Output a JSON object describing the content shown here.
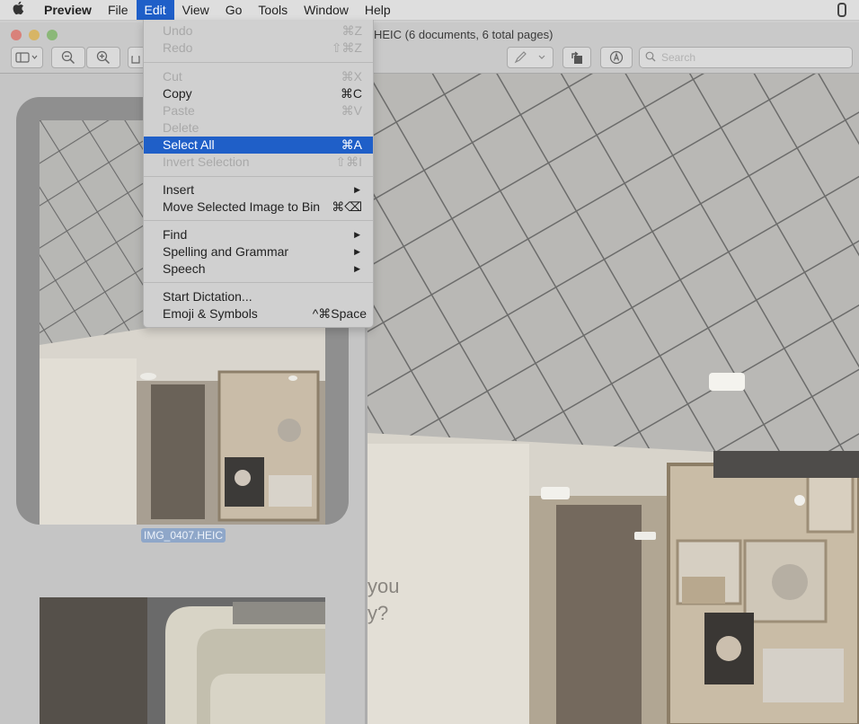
{
  "menubar": {
    "items": [
      "Preview",
      "File",
      "Edit",
      "View",
      "Go",
      "Tools",
      "Window",
      "Help"
    ]
  },
  "window": {
    "title": "HEIC (6 documents, 6 total pages)"
  },
  "search": {
    "placeholder": "Search"
  },
  "sidebar": {
    "thumbnail_label": "IMG_0407.HEIC"
  },
  "edit_menu": {
    "undo": {
      "label": "Undo",
      "shortcut": "⌘Z"
    },
    "redo": {
      "label": "Redo",
      "shortcut": "⇧⌘Z"
    },
    "cut": {
      "label": "Cut",
      "shortcut": "⌘X"
    },
    "copy": {
      "label": "Copy",
      "shortcut": "⌘C"
    },
    "paste": {
      "label": "Paste",
      "shortcut": "⌘V"
    },
    "delete": {
      "label": "Delete"
    },
    "select_all": {
      "label": "Select All",
      "shortcut": "⌘A"
    },
    "invert_selection": {
      "label": "Invert Selection",
      "shortcut": "⇧⌘I"
    },
    "insert": {
      "label": "Insert"
    },
    "move_to_bin": {
      "label": "Move Selected Image to Bin",
      "shortcut": "⌘⌫"
    },
    "find": {
      "label": "Find"
    },
    "spelling": {
      "label": "Spelling and Grammar"
    },
    "speech": {
      "label": "Speech"
    },
    "dictation": {
      "label": "Start Dictation..."
    },
    "emoji": {
      "label": "Emoji & Symbols",
      "shortcut": "^⌘Space"
    }
  },
  "photo_wall_text": {
    "line1": "you",
    "line2": "y?"
  },
  "colors": {
    "menu_highlight": "#1f5fc8",
    "thumbnail_selection": "#8fa7c9"
  }
}
